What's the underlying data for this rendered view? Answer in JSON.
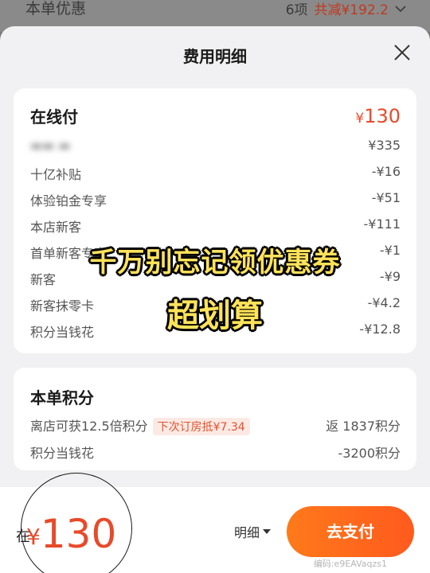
{
  "background": {
    "left_label": "本单优惠",
    "right_count": "6项",
    "right_total": "共减¥192.2"
  },
  "sheet": {
    "title": "费用明细"
  },
  "online_pay": {
    "title": "在线付",
    "amount_currency": "¥",
    "amount": "130",
    "rows": [
      {
        "label": "",
        "value": "¥335",
        "blurred": true
      },
      {
        "label": "十亿补贴",
        "value": "-¥16"
      },
      {
        "label": "体验铂金专享",
        "value": "-¥51"
      },
      {
        "label": "本店新客",
        "value": "-¥111"
      },
      {
        "label": "首单新客专享",
        "value": "-¥1"
      },
      {
        "label": "新客",
        "value": "-¥9"
      },
      {
        "label": "新客抹零卡",
        "value": "-¥4.2"
      },
      {
        "label": "积分当钱花",
        "value": "-¥12.8"
      }
    ]
  },
  "points": {
    "title": "本单积分",
    "row1_label": "离店可获12.5倍积分",
    "row1_tag": "下次订房抵¥7.34",
    "row1_value": "返 1837积分",
    "row2_label": "积分当钱花",
    "row2_value": "-3200积分"
  },
  "overlay": {
    "line1": "千万别忘记领优惠券",
    "line2": "超划算"
  },
  "footer": {
    "left_label": "在",
    "price_currency": "¥",
    "price": "130",
    "detail_label": "明细",
    "pay_label": "去支付",
    "watermark": "编码:e9EAVaqzs1"
  },
  "colors": {
    "accent": "#e84a2a",
    "button": "#ff6a1c",
    "overlay_text": "#ffe35a"
  }
}
